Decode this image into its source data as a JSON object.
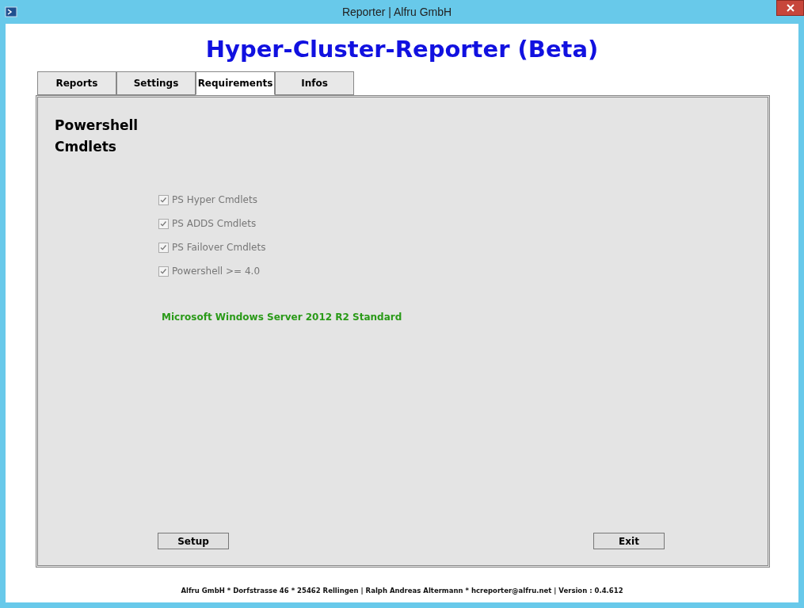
{
  "window": {
    "title": "Reporter | Alfru GmbH"
  },
  "heading": "Hyper-Cluster-Reporter (Beta)",
  "tabs": [
    {
      "label": "Reports",
      "selected": false
    },
    {
      "label": "Settings",
      "selected": false
    },
    {
      "label": "Requirements",
      "selected": true
    },
    {
      "label": "Infos",
      "selected": false
    }
  ],
  "section_title": "Powershell Cmdlets",
  "checks": [
    {
      "label": "PS Hyper Cmdlets",
      "checked": true,
      "disabled": true
    },
    {
      "label": "PS ADDS Cmdlets",
      "checked": true,
      "disabled": true
    },
    {
      "label": "PS Failover Cmdlets",
      "checked": true,
      "disabled": true
    },
    {
      "label": "Powershell >= 4.0",
      "checked": true,
      "disabled": true
    }
  ],
  "os_info": "Microsoft Windows Server 2012 R2 Standard",
  "buttons": [
    "Setup",
    "Exit"
  ],
  "footer": "Alfru GmbH * Dorfstrasse 46 * 25462 Rellingen | Ralph Andreas Altermann * hcreporter@alfru.net | Version : 0.4.612"
}
